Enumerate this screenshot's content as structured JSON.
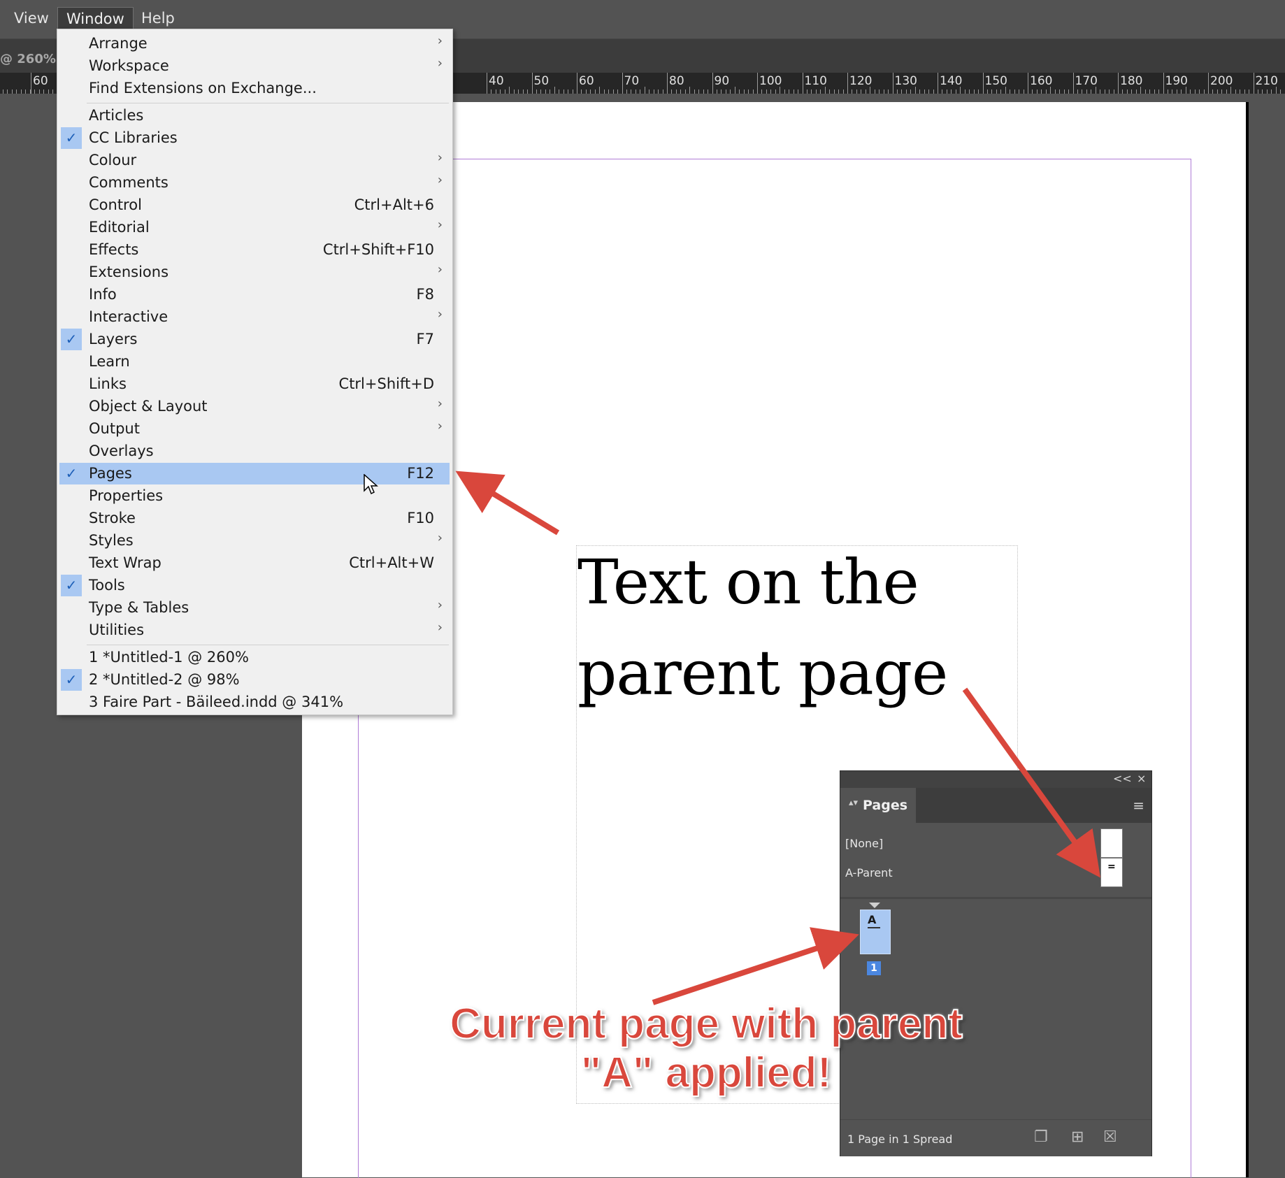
{
  "menubar": {
    "items": [
      "View",
      "Window",
      "Help"
    ],
    "active": "Window"
  },
  "document_tab": "@ 260% [(",
  "ruler": {
    "left_labels": [
      "60"
    ],
    "labels": [
      "40",
      "50",
      "60",
      "70",
      "80",
      "90",
      "100",
      "110",
      "120",
      "130",
      "140",
      "150",
      "160",
      "170",
      "180",
      "190",
      "200",
      "210"
    ]
  },
  "canvas": {
    "heading_line1": "Text on the",
    "heading_line2": "parent page"
  },
  "window_menu": {
    "items": [
      {
        "label": "Arrange",
        "shortcut": "",
        "submenu": true,
        "checked": false
      },
      {
        "label": "Workspace",
        "shortcut": "",
        "submenu": true,
        "checked": false
      },
      {
        "label": "Find Extensions on Exchange...",
        "shortcut": "",
        "submenu": false,
        "checked": false
      },
      {
        "label": "Articles",
        "shortcut": "",
        "submenu": false,
        "checked": false
      },
      {
        "label": "CC Libraries",
        "shortcut": "",
        "submenu": false,
        "checked": true
      },
      {
        "label": "Colour",
        "shortcut": "",
        "submenu": true,
        "checked": false
      },
      {
        "label": "Comments",
        "shortcut": "",
        "submenu": true,
        "checked": false
      },
      {
        "label": "Control",
        "shortcut": "Ctrl+Alt+6",
        "submenu": false,
        "checked": false
      },
      {
        "label": "Editorial",
        "shortcut": "",
        "submenu": true,
        "checked": false
      },
      {
        "label": "Effects",
        "shortcut": "Ctrl+Shift+F10",
        "submenu": false,
        "checked": false
      },
      {
        "label": "Extensions",
        "shortcut": "",
        "submenu": true,
        "checked": false
      },
      {
        "label": "Info",
        "shortcut": "F8",
        "submenu": false,
        "checked": false
      },
      {
        "label": "Interactive",
        "shortcut": "",
        "submenu": true,
        "checked": false
      },
      {
        "label": "Layers",
        "shortcut": "F7",
        "submenu": false,
        "checked": true
      },
      {
        "label": "Learn",
        "shortcut": "",
        "submenu": false,
        "checked": false
      },
      {
        "label": "Links",
        "shortcut": "Ctrl+Shift+D",
        "submenu": false,
        "checked": false
      },
      {
        "label": "Object & Layout",
        "shortcut": "",
        "submenu": true,
        "checked": false
      },
      {
        "label": "Output",
        "shortcut": "",
        "submenu": true,
        "checked": false
      },
      {
        "label": "Overlays",
        "shortcut": "",
        "submenu": false,
        "checked": false
      },
      {
        "label": "Pages",
        "shortcut": "F12",
        "submenu": false,
        "checked": true,
        "highlighted": true
      },
      {
        "label": "Properties",
        "shortcut": "",
        "submenu": false,
        "checked": false
      },
      {
        "label": "Stroke",
        "shortcut": "F10",
        "submenu": false,
        "checked": false
      },
      {
        "label": "Styles",
        "shortcut": "",
        "submenu": true,
        "checked": false
      },
      {
        "label": "Text Wrap",
        "shortcut": "Ctrl+Alt+W",
        "submenu": false,
        "checked": false
      },
      {
        "label": "Tools",
        "shortcut": "",
        "submenu": false,
        "checked": true
      },
      {
        "label": "Type & Tables",
        "shortcut": "",
        "submenu": true,
        "checked": false
      },
      {
        "label": "Utilities",
        "shortcut": "",
        "submenu": true,
        "checked": false
      },
      {
        "label": "1 *Untitled-1 @ 260%",
        "shortcut": "",
        "submenu": false,
        "checked": false
      },
      {
        "label": "2 *Untitled-2 @ 98%",
        "shortcut": "",
        "submenu": false,
        "checked": true
      },
      {
        "label": "3 Faire Part - Bäileed.indd @ 341%",
        "shortcut": "",
        "submenu": false,
        "checked": false
      }
    ]
  },
  "pages_panel": {
    "collapse_icon": "<<",
    "close_icon": "×",
    "tab_label": "Pages",
    "parents": [
      "[None]",
      "A-Parent"
    ],
    "page_thumb_letter": "A",
    "page_number": "1",
    "footer": "1 Page in 1 Spread"
  },
  "annotation": {
    "line1": "Current page with parent",
    "line2": "\"A\" applied!"
  },
  "colors": {
    "menu_highlight": "#a9c8f2",
    "arrow": "#d9473c",
    "margin_guide": "#b07cd6"
  }
}
